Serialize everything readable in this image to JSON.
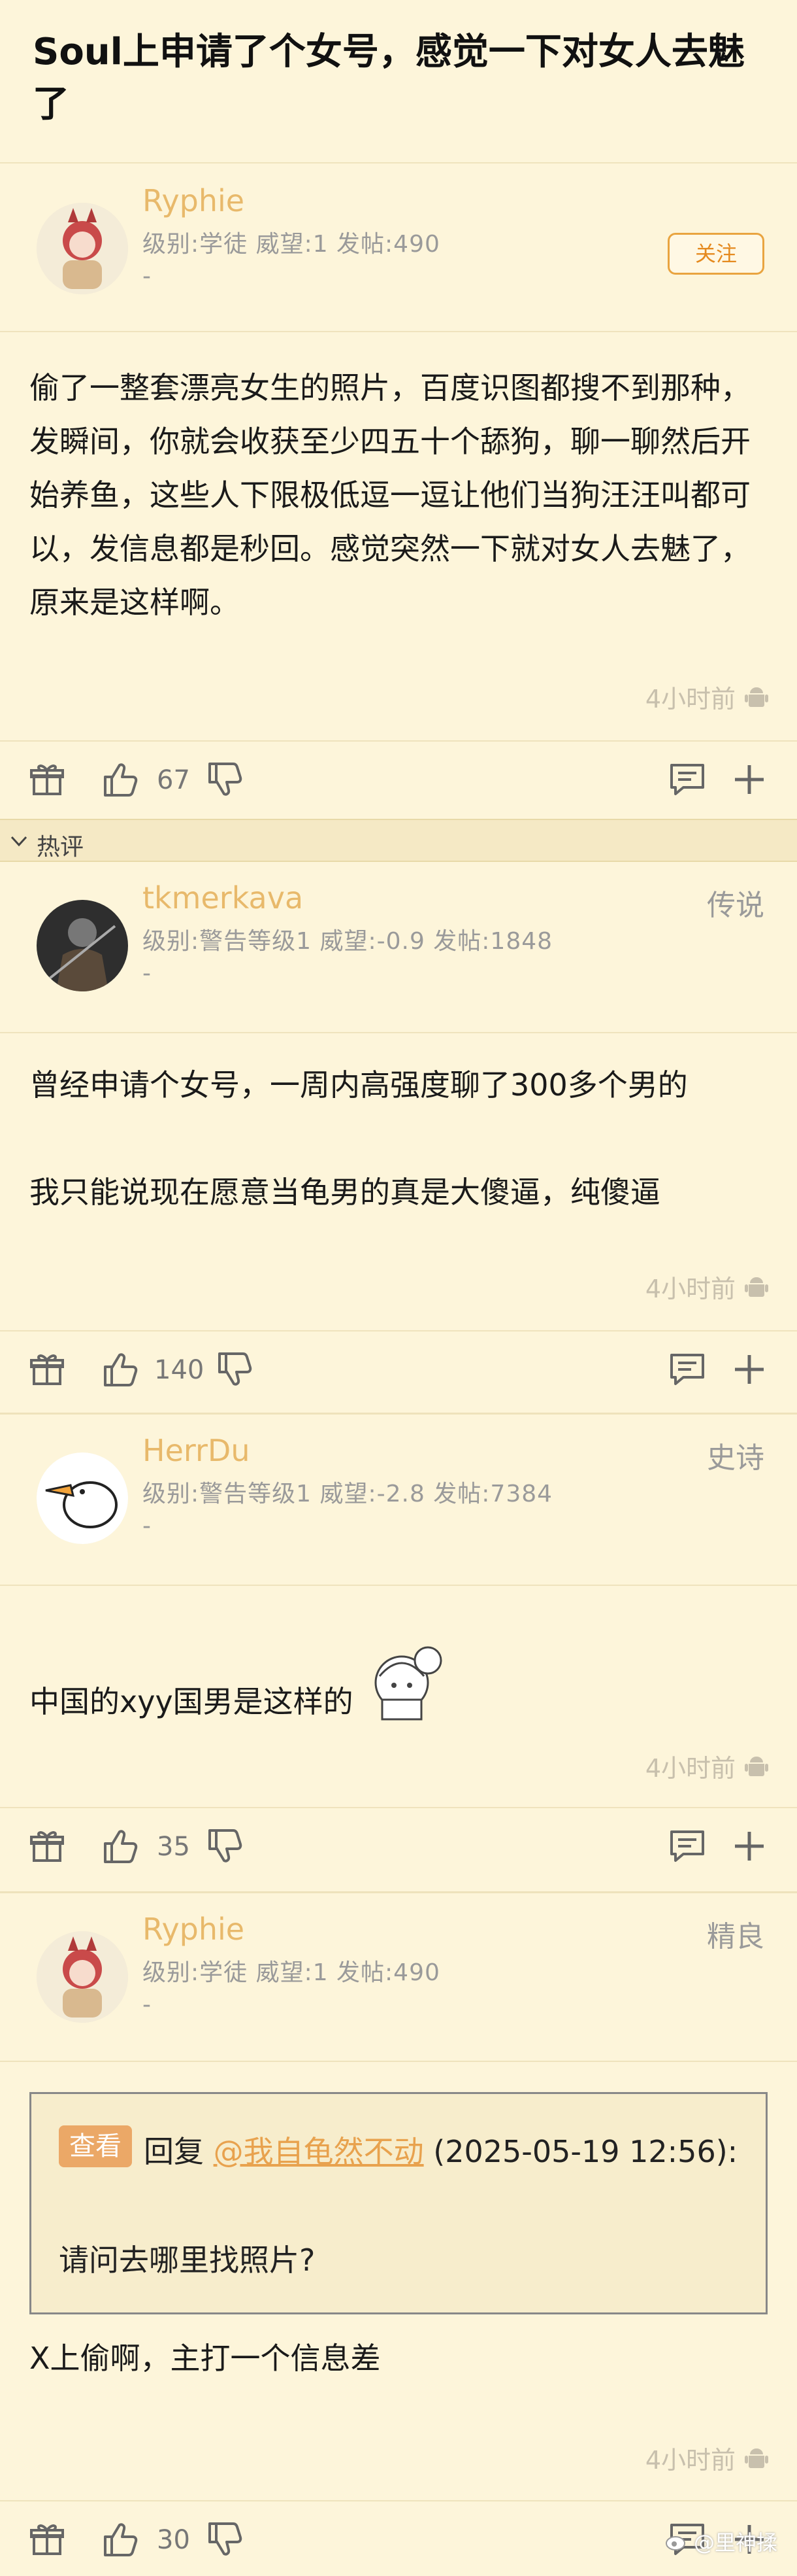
{
  "thread": {
    "title": "Soul上申请了个女号，感觉一下对女人去魅了"
  },
  "hot_section": {
    "label": "热评"
  },
  "posts": [
    {
      "username": "Ryphie",
      "meta": "级别:学徒  威望:1  发帖:490",
      "sub": "-",
      "badge": "关注",
      "body": [
        "偷了一整套漂亮女生的照片，百度识图都搜不到那种，发瞬间，你就会收获至少四五十个舔狗，聊一聊然后开始养鱼，这些人下限极低逗一逗让他们当狗汪汪叫都可以，发信息都是秒回。感觉突然一下就对女人去魅了，原来是这样啊。"
      ],
      "time": "4小时前",
      "likes": "67"
    },
    {
      "username": "tkmerkava",
      "meta": "级别:警告等级1  威望:-0.9  发帖:1848",
      "sub": "-",
      "badge": "传说",
      "body": [
        "曾经申请个女号，一周内高强度聊了300多个男的",
        "我只能说现在愿意当龟男的真是大傻逼，纯傻逼"
      ],
      "time": "4小时前",
      "likes": "140"
    },
    {
      "username": "HerrDu",
      "meta": "级别:警告等级1  威望:-2.8  发帖:7384",
      "sub": "-",
      "badge": "史诗",
      "body": [
        "中国的xyy国男是这样的"
      ],
      "time": "4小时前",
      "likes": "35"
    },
    {
      "username": "Ryphie",
      "meta": "级别:学徒  威望:1  发帖:490",
      "sub": "-",
      "badge": "精良",
      "quote": {
        "tag": "查看",
        "prefix": "回复",
        "mention": "@我自龟然不动",
        "date": "(2025-05-19 12:56):",
        "text": "请问去哪里找照片?"
      },
      "body": [
        "X上偷啊，主打一个信息差"
      ],
      "time": "4小时前",
      "likes": "30"
    }
  ],
  "watermark": "@里神揉",
  "colors": {
    "background": "#fdf5da",
    "username": "#e8b96b",
    "accent": "#e58a1f"
  }
}
